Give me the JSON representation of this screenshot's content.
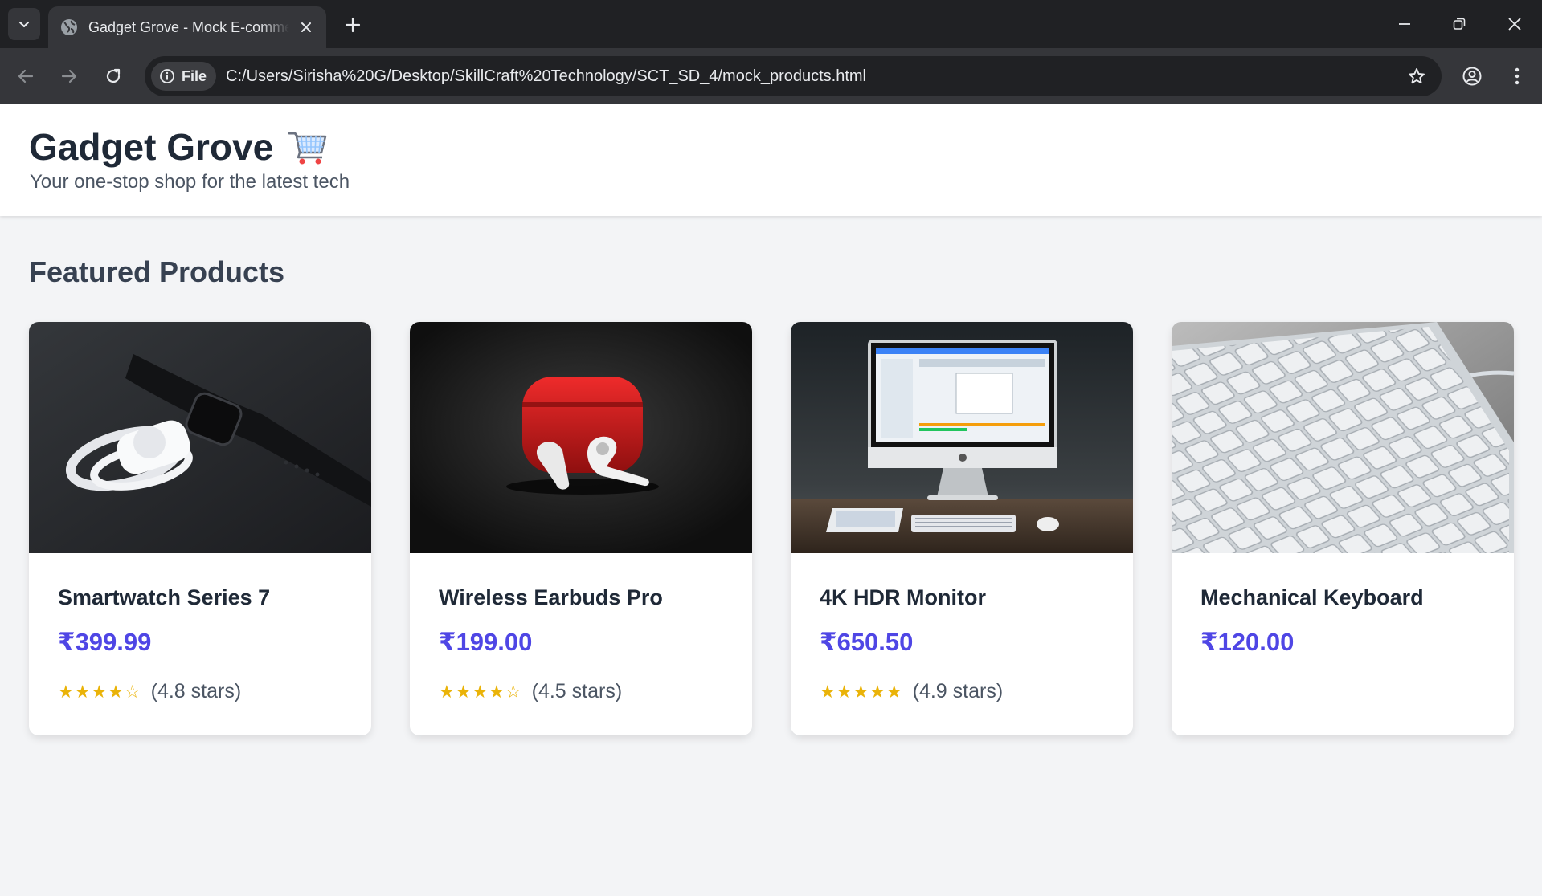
{
  "browser": {
    "tab_title": "Gadget Grove - Mock E-commerce",
    "site_chip": "File",
    "url": "C:/Users/Sirisha%20G/Desktop/SkillCraft%20Technology/SCT_SD_4/mock_products.html",
    "icons": [
      "tab-search-icon",
      "globe-icon",
      "close-icon",
      "plus-icon",
      "minimize-icon",
      "restore-icon",
      "close-window-icon",
      "back-arrow-icon",
      "forward-arrow-icon",
      "reload-icon",
      "info-icon",
      "star-icon",
      "profile-icon",
      "kebab-menu-icon"
    ]
  },
  "header": {
    "title": "Gadget Grove",
    "tagline": "Your one-stop shop for the latest tech",
    "icon": "shopping-cart-icon"
  },
  "main": {
    "section_title": "Featured Products",
    "products": [
      {
        "name": "Smartwatch Series 7",
        "price": "₹399.99",
        "stars": "★★★★☆",
        "rating_text": "(4.8 stars)",
        "rating": 4.8,
        "image": "smartwatch-photo"
      },
      {
        "name": "Wireless Earbuds Pro",
        "price": "₹199.00",
        "stars": "★★★★☆",
        "rating_text": "(4.5 stars)",
        "rating": 4.5,
        "image": "earbuds-photo"
      },
      {
        "name": "4K HDR Monitor",
        "price": "₹650.50",
        "stars": "★★★★★",
        "rating_text": "(4.9 stars)",
        "rating": 4.9,
        "image": "desktop-computer-photo"
      },
      {
        "name": "Mechanical Keyboard",
        "price": "₹120.00",
        "stars": "",
        "rating_text": "",
        "image": "keyboard-photo"
      }
    ]
  },
  "colors": {
    "page_background": "#f3f4f6",
    "price": "#4f46e5",
    "stars": "#eab308",
    "title": "#1f2937"
  }
}
